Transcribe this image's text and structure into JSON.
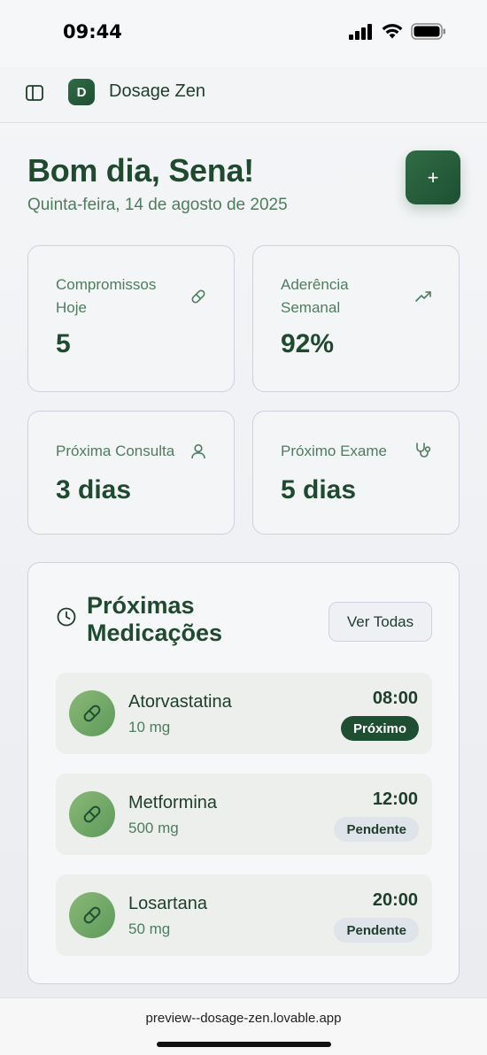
{
  "status_bar": {
    "time": "09:44"
  },
  "header": {
    "logo_letter": "D",
    "app_name": "Dosage Zen"
  },
  "greeting": {
    "title": "Bom dia, Sena!",
    "date": "Quinta-feira, 14 de agosto de 2025",
    "add_label": "+"
  },
  "stats": [
    {
      "label": "Compromissos Hoje",
      "value": "5",
      "icon": "pill-icon"
    },
    {
      "label": "Aderência Semanal",
      "value": "92%",
      "icon": "trending-up-icon"
    },
    {
      "label": "Próxima Consulta",
      "value": "3 dias",
      "icon": "user-icon"
    },
    {
      "label": "Próximo Exame",
      "value": "5 dias",
      "icon": "stethoscope-icon"
    }
  ],
  "medications": {
    "title": "Próximas Medicações",
    "view_all_label": "Ver Todas",
    "items": [
      {
        "name": "Atorvastatina",
        "dose": "10 mg",
        "time": "08:00",
        "status": "Próximo"
      },
      {
        "name": "Metformina",
        "dose": "500 mg",
        "time": "12:00",
        "status": "Pendente"
      },
      {
        "name": "Losartana",
        "dose": "50 mg",
        "time": "20:00",
        "status": "Pendente"
      }
    ]
  },
  "browser": {
    "url": "preview--dosage-zen.lovable.app"
  },
  "colors": {
    "primary": "#1e4f32",
    "accent_text": "#4f7c5f",
    "pill_green": "#6fa565",
    "pending_badge": "#dfe3ea"
  }
}
